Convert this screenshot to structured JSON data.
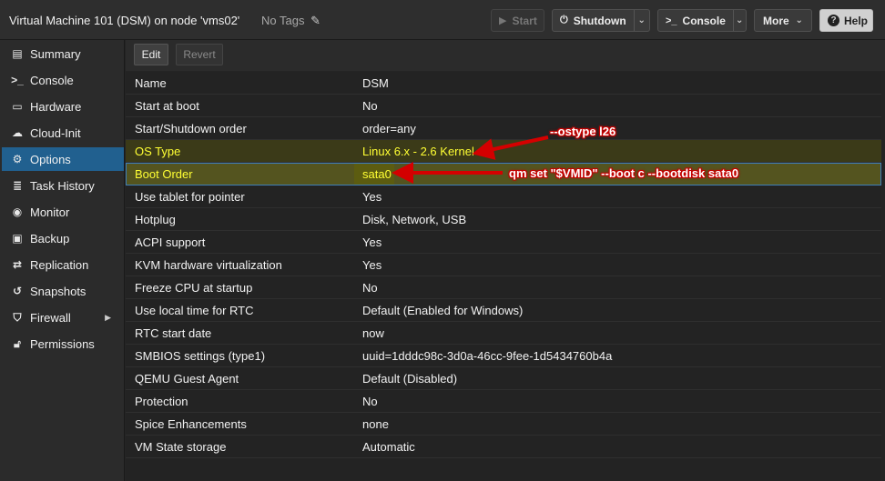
{
  "header": {
    "title": "Virtual Machine 101 (DSM) on node 'vms02'",
    "tags": "No Tags",
    "buttons": {
      "start": "Start",
      "shutdown": "Shutdown",
      "console": "Console",
      "more": "More",
      "help": "Help"
    }
  },
  "sidebar": {
    "items": [
      {
        "label": "Summary",
        "icon": "book-icon"
      },
      {
        "label": "Console",
        "icon": "terminal-icon"
      },
      {
        "label": "Hardware",
        "icon": "monitor-icon"
      },
      {
        "label": "Cloud-Init",
        "icon": "cloud-icon"
      },
      {
        "label": "Options",
        "icon": "gear-icon",
        "active": true
      },
      {
        "label": "Task History",
        "icon": "list-icon"
      },
      {
        "label": "Monitor",
        "icon": "eye-icon"
      },
      {
        "label": "Backup",
        "icon": "floppy-icon"
      },
      {
        "label": "Replication",
        "icon": "retweet-icon"
      },
      {
        "label": "Snapshots",
        "icon": "history-icon"
      },
      {
        "label": "Firewall",
        "icon": "shield-icon"
      },
      {
        "label": "Permissions",
        "icon": "unlock-icon"
      }
    ]
  },
  "toolbar": {
    "edit_label": "Edit",
    "revert_label": "Revert"
  },
  "options": [
    {
      "key": "Name",
      "value": "DSM"
    },
    {
      "key": "Start at boot",
      "value": "No"
    },
    {
      "key": "Start/Shutdown order",
      "value": "order=any"
    },
    {
      "key": "OS Type",
      "value": "Linux 6.x - 2.6 Kernel"
    },
    {
      "key": "Boot Order",
      "value": "sata0"
    },
    {
      "key": "Use tablet for pointer",
      "value": "Yes"
    },
    {
      "key": "Hotplug",
      "value": "Disk, Network, USB"
    },
    {
      "key": "ACPI support",
      "value": "Yes"
    },
    {
      "key": "KVM hardware virtualization",
      "value": "Yes"
    },
    {
      "key": "Freeze CPU at startup",
      "value": "No"
    },
    {
      "key": "Use local time for RTC",
      "value": "Default (Enabled for Windows)"
    },
    {
      "key": "RTC start date",
      "value": "now"
    },
    {
      "key": "SMBIOS settings (type1)",
      "value": "uuid=1dddc98c-3d0a-46cc-9fee-1d5434760b4a"
    },
    {
      "key": "QEMU Guest Agent",
      "value": "Default (Disabled)"
    },
    {
      "key": "Protection",
      "value": "No"
    },
    {
      "key": "Spice Enhancements",
      "value": "none"
    },
    {
      "key": "VM State storage",
      "value": "Automatic"
    }
  ],
  "annotations": {
    "ostype": "--ostype l26",
    "boot": "qm set \"$VMID\" --boot c --bootdisk sata0"
  },
  "colors": {
    "accent": "#21608f",
    "highlight_text": "#ffff33",
    "annotation_red": "#c40000"
  }
}
